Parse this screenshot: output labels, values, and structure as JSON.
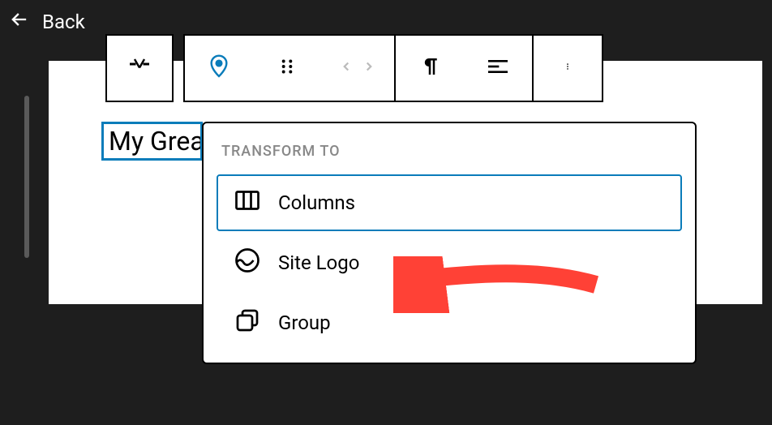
{
  "header": {
    "back_label": "Back"
  },
  "block": {
    "site_title_text": "My Great Site"
  },
  "popover": {
    "heading": "TRANSFORM TO",
    "items": [
      {
        "label": "Columns",
        "icon": "columns",
        "highlighted": true
      },
      {
        "label": "Site Logo",
        "icon": "site-logo",
        "highlighted": false
      },
      {
        "label": "Group",
        "icon": "group",
        "highlighted": false
      }
    ]
  }
}
